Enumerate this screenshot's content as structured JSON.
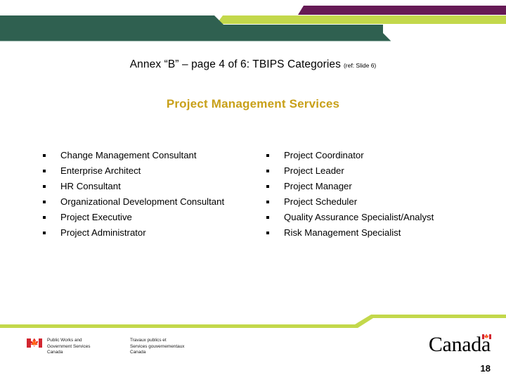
{
  "slide": {
    "title_main": "Annex “B” – page 4 of 6:  TBIPS Categories",
    "title_ref": "(ref: Slide 6)",
    "subtitle": "Project Management Services",
    "slide_number": "18"
  },
  "columns": {
    "left": [
      "Change Management Consultant",
      "Enterprise Architect",
      "HR Consultant",
      "Organizational Development Consultant",
      "Project Executive",
      "Project Administrator"
    ],
    "right": [
      "Project Coordinator",
      "Project Leader",
      "Project Manager",
      "Project Scheduler",
      "Quality Assurance Specialist/Analyst",
      "Risk Management Specialist"
    ]
  },
  "footer": {
    "department_en": "Public Works and\nGovernment Services\nCanada",
    "department_fr": "Travaux publics et\nServices gouvernementaux\nCanada",
    "wordmark": "Canada",
    "flag_leaf": "🍁"
  },
  "theme": {
    "dark_green": "#2f6050",
    "lime_green": "#c3d84b",
    "purple": "#661a55",
    "gold": "#c8a019",
    "flag_red": "#d22630",
    "black": "#000000",
    "white": "#ffffff"
  }
}
